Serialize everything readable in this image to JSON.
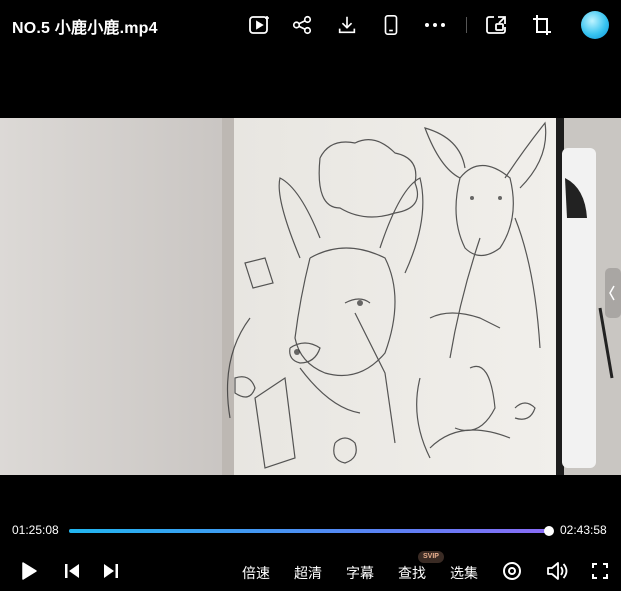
{
  "header": {
    "title": "NO.5 小鹿小鹿.mp4",
    "icons": [
      "video-plus-icon",
      "share-icon",
      "download-icon",
      "phone-icon",
      "more-icon",
      "pip-icon",
      "crop-icon",
      "avatar"
    ]
  },
  "video": {
    "description_icon": "sketchbook-deer-drawing"
  },
  "progress": {
    "current_time": "01:25:08",
    "total_time": "02:43:58",
    "played_fraction": 0.9956
  },
  "controls": {
    "speed_label": "倍速",
    "quality_label": "超清",
    "subtitle_label": "字幕",
    "search_label": "查找",
    "search_badge": "SVIP",
    "episodes_label": "选集"
  },
  "colors": {
    "progress_start": "#21b6f0",
    "progress_end": "#8a6cf7",
    "background": "#000000"
  }
}
